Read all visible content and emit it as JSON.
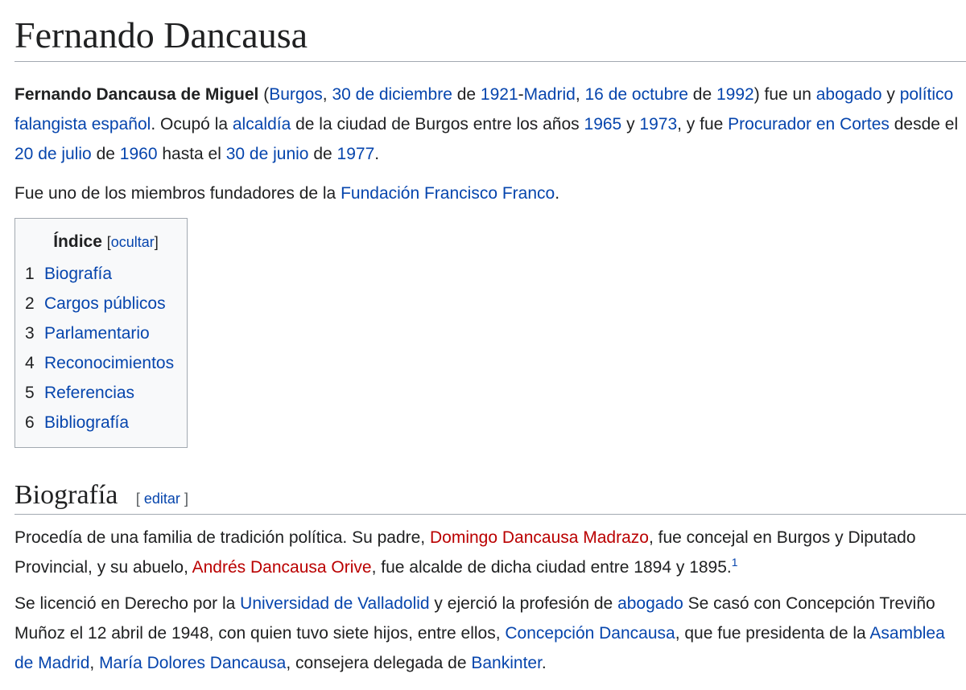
{
  "article": {
    "title": "Fernando Dancausa"
  },
  "lead1": [
    {
      "t": "Fernando Dancausa de Miguel",
      "s": "bold"
    },
    {
      "t": " (",
      "s": "text"
    },
    {
      "t": "Burgos",
      "s": "link"
    },
    {
      "t": ", ",
      "s": "text"
    },
    {
      "t": "30 de diciembre",
      "s": "link"
    },
    {
      "t": " de ",
      "s": "text"
    },
    {
      "t": "1921",
      "s": "link"
    },
    {
      "t": "-",
      "s": "text"
    },
    {
      "t": "Madrid",
      "s": "link"
    },
    {
      "t": ", ",
      "s": "text"
    },
    {
      "t": "16 de octubre",
      "s": "link"
    },
    {
      "t": " de ",
      "s": "text"
    },
    {
      "t": "1992",
      "s": "link"
    },
    {
      "t": ") fue un ",
      "s": "text"
    },
    {
      "t": "abogado",
      "s": "link"
    },
    {
      "t": " y ",
      "s": "text"
    },
    {
      "t": "político",
      "s": "link"
    },
    {
      "t": " ",
      "s": "text"
    },
    {
      "t": "falangista",
      "s": "link"
    },
    {
      "t": " ",
      "s": "text"
    },
    {
      "t": "español",
      "s": "link"
    },
    {
      "t": ". Ocupó la ",
      "s": "text"
    },
    {
      "t": "alcaldía",
      "s": "link"
    },
    {
      "t": " de la ciudad de Burgos entre los años ",
      "s": "text"
    },
    {
      "t": "1965",
      "s": "link"
    },
    {
      "t": " y ",
      "s": "text"
    },
    {
      "t": "1973",
      "s": "link"
    },
    {
      "t": ", y fue ",
      "s": "text"
    },
    {
      "t": "Procurador en Cortes",
      "s": "link"
    },
    {
      "t": " desde el ",
      "s": "text"
    },
    {
      "t": "20 de julio",
      "s": "link"
    },
    {
      "t": " de ",
      "s": "text"
    },
    {
      "t": "1960",
      "s": "link"
    },
    {
      "t": " hasta el ",
      "s": "text"
    },
    {
      "t": "30 de junio",
      "s": "link"
    },
    {
      "t": " de ",
      "s": "text"
    },
    {
      "t": "1977",
      "s": "link"
    },
    {
      "t": ".",
      "s": "text"
    }
  ],
  "lead2": [
    {
      "t": "Fue uno de los miembros fundadores de la ",
      "s": "text"
    },
    {
      "t": "Fundación Francisco Franco",
      "s": "link"
    },
    {
      "t": ".",
      "s": "text"
    }
  ],
  "toc": {
    "title": "Índice",
    "toggle_open": "[",
    "toggle_label": "ocultar",
    "toggle_close": "]",
    "items": [
      {
        "num": "1",
        "label": "Biografía"
      },
      {
        "num": "2",
        "label": "Cargos públicos"
      },
      {
        "num": "3",
        "label": "Parlamentario"
      },
      {
        "num": "4",
        "label": "Reconocimientos"
      },
      {
        "num": "5",
        "label": "Referencias"
      },
      {
        "num": "6",
        "label": "Bibliografía"
      }
    ]
  },
  "section": {
    "heading": "Biografía",
    "edit_open": "[",
    "edit_label": "editar",
    "edit_close": "]"
  },
  "body1": [
    {
      "t": "Procedía de una familia de tradición política. Su padre, ",
      "s": "text"
    },
    {
      "t": "Domingo Dancausa Madrazo",
      "s": "red"
    },
    {
      "t": ", fue concejal en Burgos y Diputado Provincial, y su abuelo, ",
      "s": "text"
    },
    {
      "t": "Andrés Dancausa Orive",
      "s": "red"
    },
    {
      "t": ", fue alcalde de dicha ciudad entre 1894 y 1895.",
      "s": "text"
    },
    {
      "t": "1",
      "s": "sup"
    }
  ],
  "body2": [
    {
      "t": "Se licenció en Derecho por la ",
      "s": "text"
    },
    {
      "t": "Universidad de Valladolid",
      "s": "link"
    },
    {
      "t": " y ejerció la profesión de ",
      "s": "text"
    },
    {
      "t": "abogado",
      "s": "link"
    },
    {
      "t": " Se casó con Concepción Treviño Muñoz el 12 abril de 1948, con quien tuvo siete hijos, entre ellos, ",
      "s": "text"
    },
    {
      "t": "Concepción Dancausa",
      "s": "link"
    },
    {
      "t": ", que fue presidenta de la ",
      "s": "text"
    },
    {
      "t": "Asamblea de Madrid",
      "s": "link"
    },
    {
      "t": ", ",
      "s": "text"
    },
    {
      "t": "María Dolores Dancausa",
      "s": "link"
    },
    {
      "t": ", consejera delegada de ",
      "s": "text"
    },
    {
      "t": "Bankinter",
      "s": "link"
    },
    {
      "t": ".",
      "s": "text"
    }
  ],
  "colors": {
    "link": "#0645ad",
    "redlink": "#ba0000",
    "text": "#202122"
  }
}
